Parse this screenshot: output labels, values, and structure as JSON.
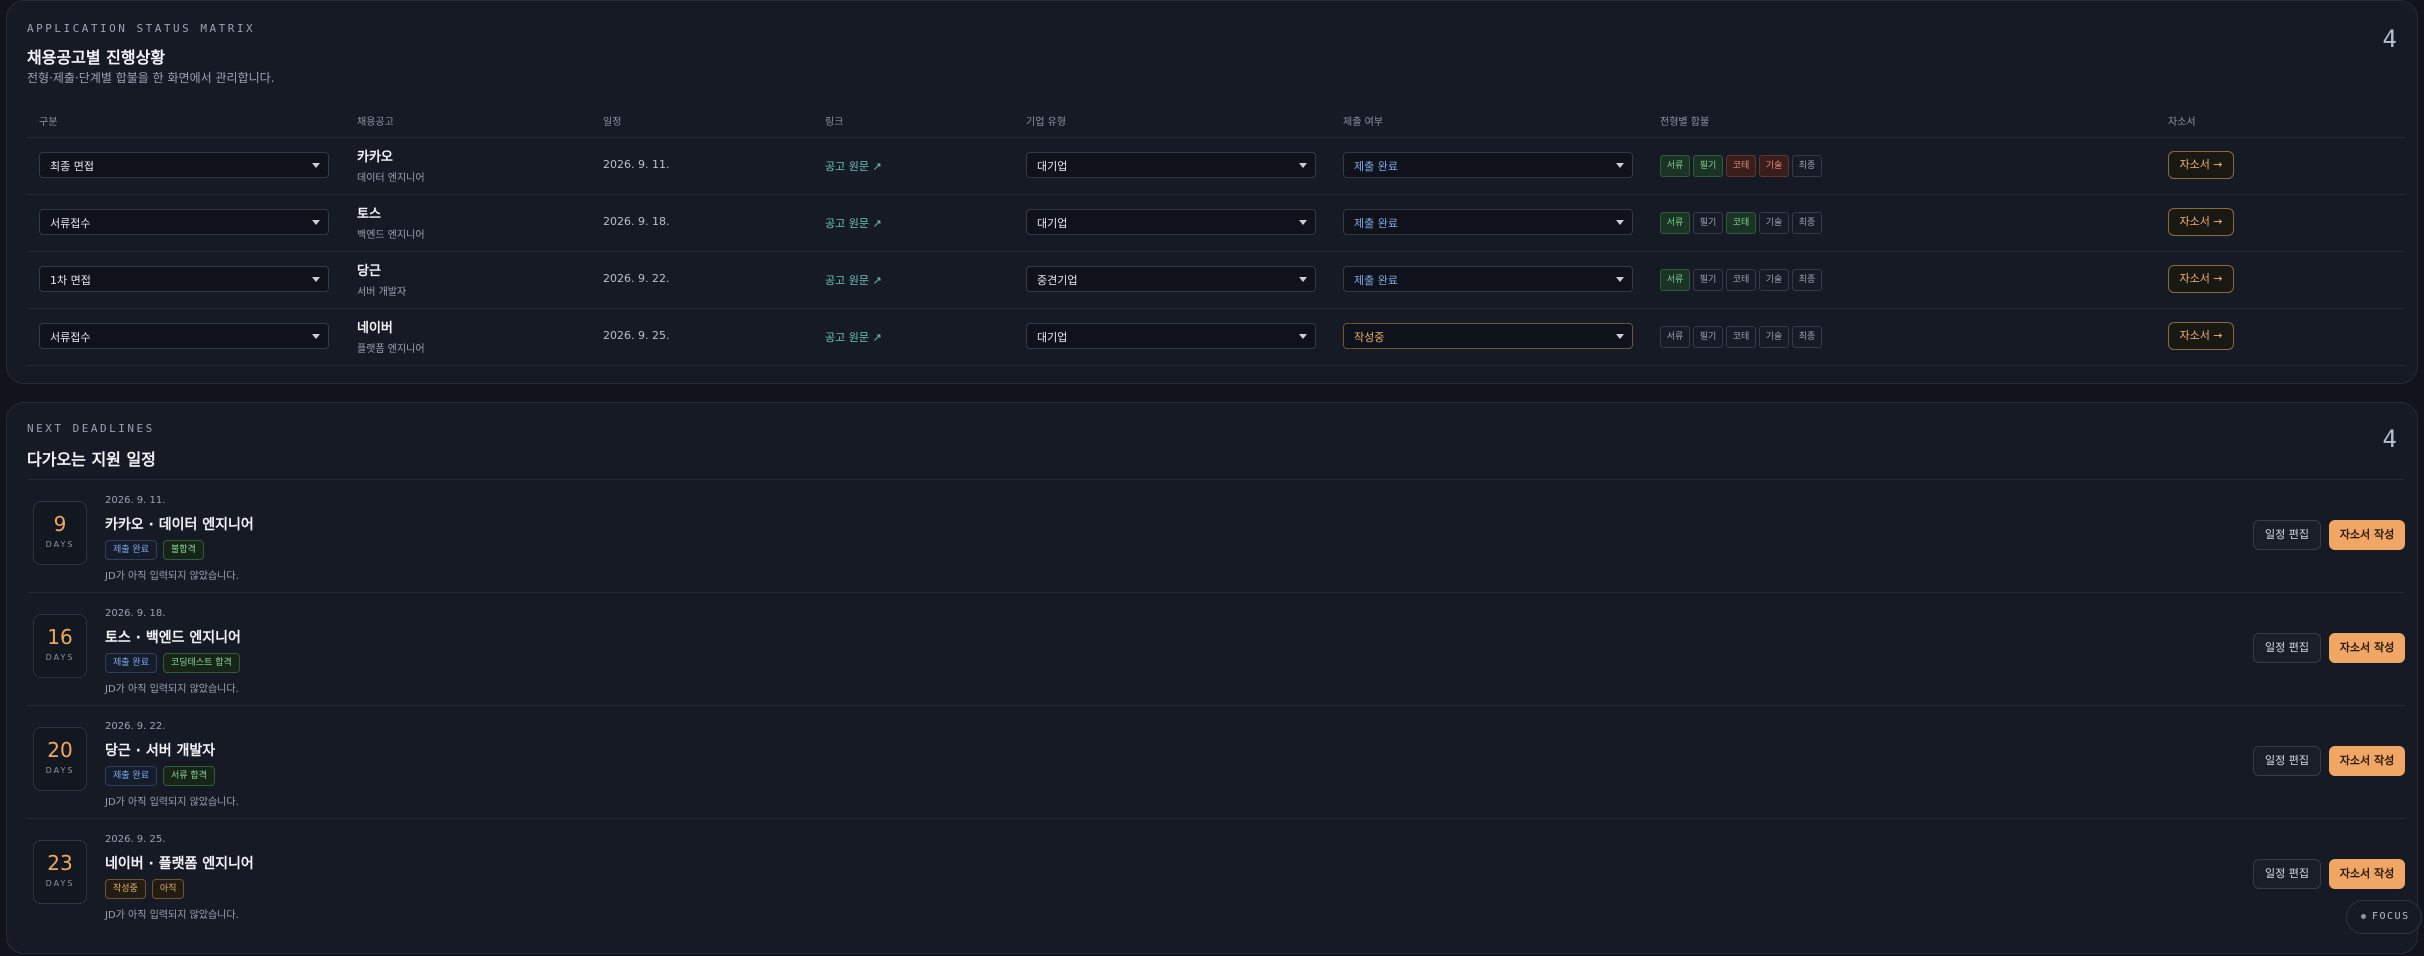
{
  "status": {
    "kicker": "APPLICATION STATUS MATRIX",
    "title": "채용공고별 진행상황",
    "subtitle": "전형·제출·단계별 합불을 한 화면에서 관리합니다.",
    "count": "4",
    "headers": [
      "구분",
      "채용공고",
      "일정",
      "링크",
      "기업 유형",
      "제출 여부",
      "전형별 합불",
      "자소서"
    ],
    "rows": [
      {
        "category": "최종 면접",
        "company": "카카오",
        "role": "데이터 엔지니어",
        "date": "2026. 9. 11.",
        "link": "공고 원문 ↗",
        "company_type": "대기업",
        "submit": "제출 완료",
        "essay": "자소서 →",
        "stages": [
          {
            "label": "서류",
            "state": "pass"
          },
          {
            "label": "필기",
            "state": "pass"
          },
          {
            "label": "코테",
            "state": "fail"
          },
          {
            "label": "기술",
            "state": "fail"
          },
          {
            "label": "최종",
            "state": "none"
          }
        ]
      },
      {
        "category": "서류접수",
        "company": "토스",
        "role": "백엔드 엔지니어",
        "date": "2026. 9. 18.",
        "link": "공고 원문 ↗",
        "company_type": "대기업",
        "submit": "제출 완료",
        "essay": "자소서 →",
        "stages": [
          {
            "label": "서류",
            "state": "pass"
          },
          {
            "label": "필기",
            "state": "none"
          },
          {
            "label": "코테",
            "state": "pass"
          },
          {
            "label": "기술",
            "state": "none"
          },
          {
            "label": "최종",
            "state": "none"
          }
        ]
      },
      {
        "category": "1차 면접",
        "company": "당근",
        "role": "서버 개발자",
        "date": "2026. 9. 22.",
        "link": "공고 원문 ↗",
        "company_type": "중견기업",
        "submit": "제출 완료",
        "essay": "자소서 →",
        "stages": [
          {
            "label": "서류",
            "state": "pass"
          },
          {
            "label": "필기",
            "state": "none"
          },
          {
            "label": "코테",
            "state": "none"
          },
          {
            "label": "기술",
            "state": "none"
          },
          {
            "label": "최종",
            "state": "none"
          }
        ]
      },
      {
        "category": "서류접수",
        "company": "네이버",
        "role": "플랫폼 엔지니어",
        "date": "2026. 9. 25.",
        "link": "공고 원문 ↗",
        "company_type": "대기업",
        "submit": "작성중",
        "essay": "자소서 →",
        "stages": [
          {
            "label": "서류",
            "state": "none"
          },
          {
            "label": "필기",
            "state": "none"
          },
          {
            "label": "코테",
            "state": "none"
          },
          {
            "label": "기술",
            "state": "none"
          },
          {
            "label": "최종",
            "state": "none"
          }
        ]
      }
    ]
  },
  "deadlines": {
    "kicker": "NEXT DEADLINES",
    "title": "다가오는 지원 일정",
    "count": "4",
    "days_unit": "DAYS",
    "edit_label": "일정 편집",
    "write_label": "자소서 작성",
    "items": [
      {
        "days": "9",
        "date": "2026. 9. 11.",
        "title": "카카오 · 데이터 엔지니어",
        "badges": [
          {
            "text": "제출 완료",
            "tone": "blue"
          },
          {
            "text": "불합격",
            "tone": "green"
          }
        ],
        "jd": "JD가 아직 입력되지 않았습니다."
      },
      {
        "days": "16",
        "date": "2026. 9. 18.",
        "title": "토스 · 백엔드 엔지니어",
        "badges": [
          {
            "text": "제출 완료",
            "tone": "blue"
          },
          {
            "text": "코딩테스트 합격",
            "tone": "green"
          }
        ],
        "jd": "JD가 아직 입력되지 않았습니다."
      },
      {
        "days": "20",
        "date": "2026. 9. 22.",
        "title": "당근 · 서버 개발자",
        "badges": [
          {
            "text": "제출 완료",
            "tone": "blue"
          },
          {
            "text": "서류 합격",
            "tone": "green"
          }
        ],
        "jd": "JD가 아직 입력되지 않았습니다."
      },
      {
        "days": "23",
        "date": "2026. 9. 25.",
        "title": "네이버 · 플랫폼 엔지니어",
        "badges": [
          {
            "text": "작성중",
            "tone": "amber"
          },
          {
            "text": "아직",
            "tone": "amber"
          }
        ],
        "jd": "JD가 아직 입력되지 않았습니다."
      }
    ]
  },
  "focus": {
    "label": "FOCUS"
  },
  "colors": {
    "accent": "#f0a664",
    "pass": "#7bd08f",
    "fail": "#e08a7d",
    "link": "#6cc4b9",
    "submit_blue": "#7fa8e6"
  }
}
